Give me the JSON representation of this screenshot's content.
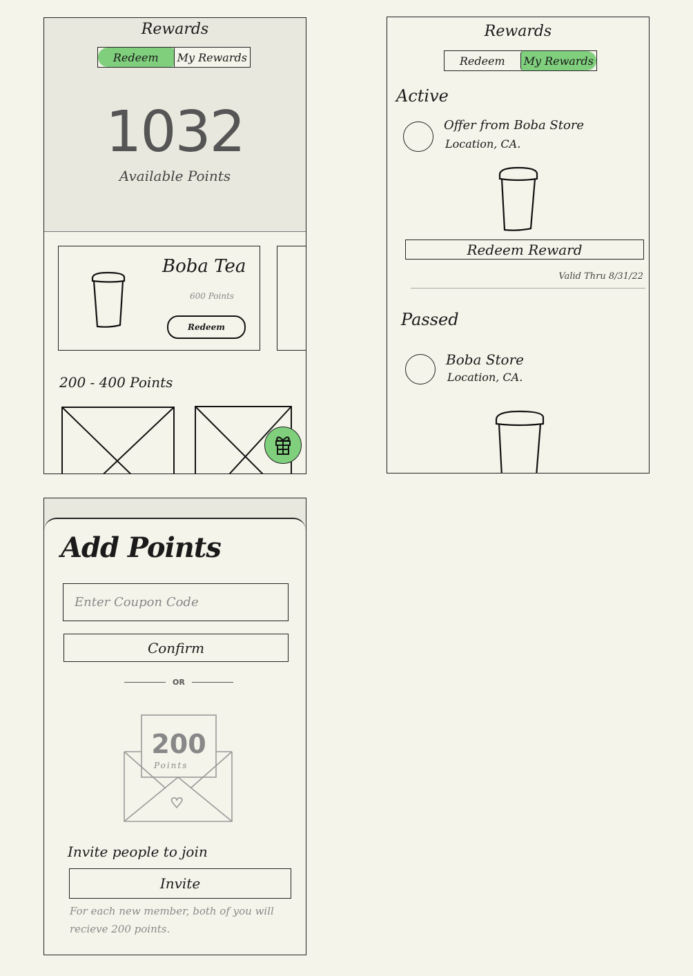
{
  "screens": {
    "redeem": {
      "title": "Rewards",
      "tabs": [
        {
          "label": "Redeem",
          "active": true
        },
        {
          "label": "My Rewards",
          "active": false
        }
      ],
      "points_value": "1032",
      "points_label": "Available Points",
      "featured_card": {
        "title": "Boba Tea",
        "points": "600 Points",
        "button_label": "Redeem"
      },
      "section_heading": "200 - 400 Points",
      "fab_icon": "gift-icon"
    },
    "my_rewards": {
      "title": "Rewards",
      "tabs": [
        {
          "label": "Redeem",
          "active": false
        },
        {
          "label": "My Rewards",
          "active": true
        }
      ],
      "active_heading": "Active",
      "active_item": {
        "line1": "Offer from Boba Store",
        "line2": "Location, CA."
      },
      "redeem_button_label": "Redeem Reward",
      "valid_text": "Valid Thru 8/31/22",
      "passed_heading": "Passed",
      "passed_item": {
        "line1": "Boba Store",
        "line2": "Location, CA."
      }
    },
    "add_points": {
      "title": "Add Points",
      "coupon_placeholder": "Enter Coupon Code",
      "confirm_label": "Confirm",
      "or_label": "OR",
      "envelope_value": "200",
      "envelope_label": "Points",
      "invite_heading": "Invite people to join",
      "invite_button_label": "Invite",
      "invite_note": "For each new member, both of you will recieve 200 points."
    }
  },
  "colors": {
    "accent_green": "#7fcf7d",
    "background": "#f4f4ea",
    "hero_background": "#e8e8de"
  }
}
